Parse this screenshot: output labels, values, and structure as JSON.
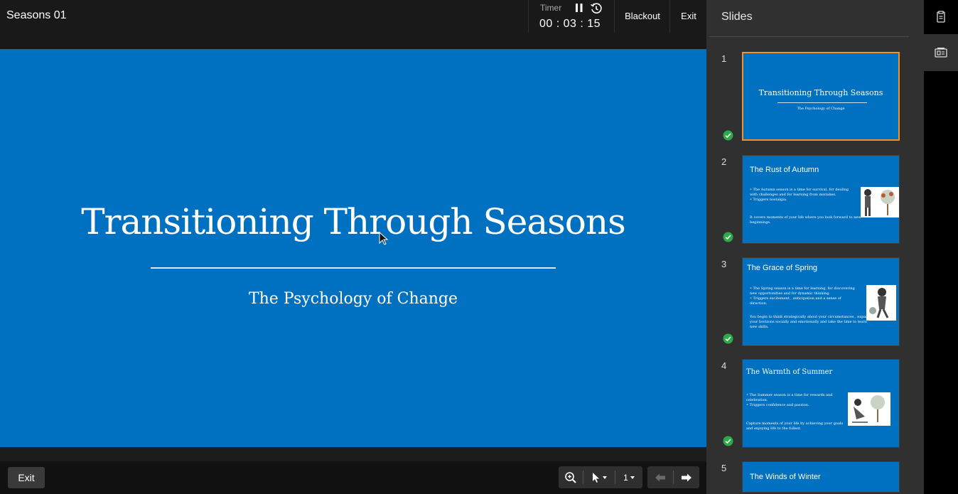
{
  "header": {
    "deck_title": "Seasons 01",
    "timer_label": "Timer",
    "timer_value": "00 : 03 : 15",
    "blackout_label": "Blackout",
    "exit_label": "Exit"
  },
  "stage": {
    "title": "Transitioning Through Seasons",
    "subtitle": "The Psychology of Change",
    "background": "#0070c0"
  },
  "footer": {
    "exit_label": "Exit",
    "page_number": "1"
  },
  "panel": {
    "title": "Slides",
    "slides": [
      {
        "number": "1",
        "title": "Transitioning Through Seasons",
        "subtitle": "The Psychology of Change",
        "viewed": true,
        "active": true
      },
      {
        "number": "2",
        "title": "The Rust of Autumn",
        "bullets": [
          "The Autumn season is a time for survival, for dealing with challenges and for learning from mistakes.",
          "Triggers nostalgia."
        ],
        "paragraph": "It covers moments of your life where you look forward to new beginnings.",
        "viewed": true
      },
      {
        "number": "3",
        "title": "The Grace of Spring",
        "bullets": [
          "The Spring season is a time for learning, for discovering new opportunities and for dynamic thinking.",
          "Triggers excitement , anticipation and a sense of direction."
        ],
        "paragraph": "You begin to think strategically about your circumstances , expand your horizons socially and emotionally and take the time to learn new skills.",
        "viewed": true
      },
      {
        "number": "4",
        "title": "The Warmth of Summer",
        "bullets": [
          "The Summer season is a time for rewards and celebration.",
          "Triggers confidence and passion."
        ],
        "paragraph": "Capture moments of your life by achieving your goals and enjoying life to the fullest.",
        "viewed": true
      },
      {
        "number": "5",
        "title": "The Winds of Winter"
      }
    ]
  },
  "colors": {
    "accent": "#f0932b",
    "slide_blue": "#0070c0",
    "check_green": "#2eaa4a"
  },
  "icons": [
    "pause-icon",
    "timer-reset-icon",
    "zoom-icon",
    "pointer-icon",
    "prev-arrow-icon",
    "next-arrow-icon",
    "check-icon",
    "notes-icon",
    "slides-panel-icon"
  ]
}
